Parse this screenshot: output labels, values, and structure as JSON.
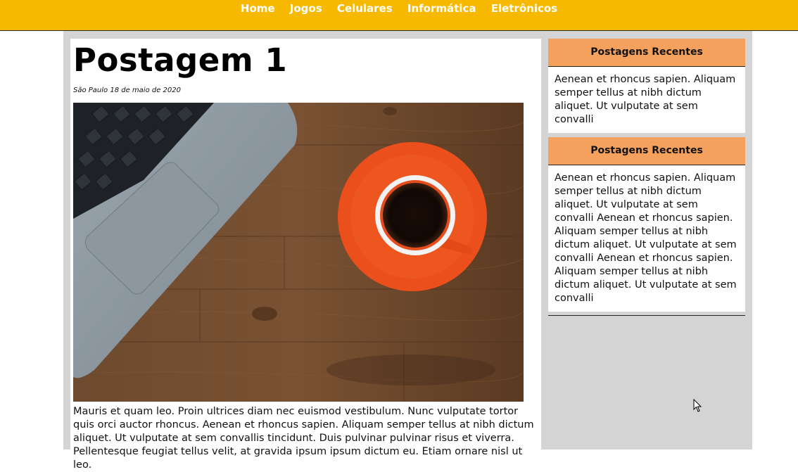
{
  "nav": {
    "items": [
      "Home",
      "Jogos",
      "Celulares",
      "Informática",
      "Eletrônicos"
    ]
  },
  "post": {
    "title": "Postagem 1",
    "date": "São Paulo 18 de maio de 2020",
    "image_label": "laptop-and-coffee-photo",
    "body": "Mauris et quam leo. Proin ultrices diam nec euismod vestibulum. Nunc vulputate tortor quis orci auctor rhoncus. Aenean et rhoncus sapien. Aliquam semper tellus at nibh dictum aliquet. Ut vulputate at sem convallis tincidunt. Duis pulvinar pulvinar risus et viverra. Pellentesque feugiat tellus velit, at gravida ipsum ipsum dictum eu. Etiam ornare nisl ut leo."
  },
  "sidebar": {
    "widgets": [
      {
        "title": "Postagens Recentes",
        "text": "Aenean et rhoncus sapien. Aliquam semper tellus at nibh dictum aliquet. Ut vulputate at sem convalli"
      },
      {
        "title": "Postagens Recentes",
        "text": "Aenean et rhoncus sapien. Aliquam semper tellus at nibh dictum aliquet. Ut vulputate at sem convalli Aenean et rhoncus sapien. Aliquam semper tellus at nibh dictum aliquet. Ut vulputate at sem convalli Aenean et rhoncus sapien. Aliquam semper tellus at nibh dictum aliquet. Ut vulputate at sem convalli"
      }
    ]
  },
  "colors": {
    "topbar": "#f7b900",
    "widget_header": "#f4a15e",
    "frame": "#d4d4d4"
  }
}
